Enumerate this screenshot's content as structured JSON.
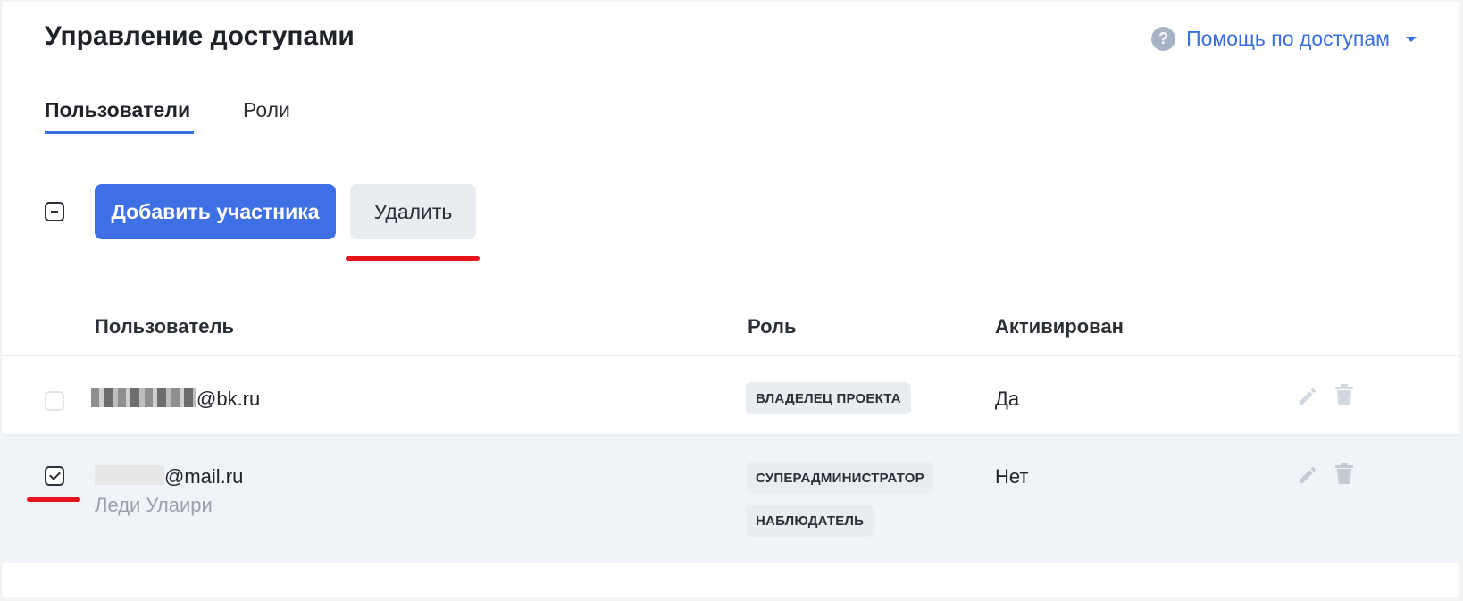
{
  "header": {
    "title": "Управление доступами",
    "help_label": "Помощь по доступам",
    "help_icon_glyph": "?"
  },
  "tabs": [
    {
      "label": "Пользователи",
      "active": true
    },
    {
      "label": "Роли",
      "active": false
    }
  ],
  "toolbar": {
    "add_label": "Добавить участника",
    "delete_label": "Удалить"
  },
  "table": {
    "columns": [
      "Пользователь",
      "Роль",
      "Активирован"
    ],
    "rows": [
      {
        "email_suffix": "@bk.ru",
        "name": "",
        "roles": [
          "ВЛАДЕЛЕЦ ПРОЕКТА"
        ],
        "activated": "Да",
        "selected": false
      },
      {
        "email_suffix": "@mail.ru",
        "name": "Леди Улаири",
        "roles": [
          "СУПЕРАДМИНИСТРАТОР",
          "НАБЛЮДАТЕЛЬ"
        ],
        "activated": "Нет",
        "selected": true
      }
    ]
  },
  "colors": {
    "accent": "#3e6fe4",
    "annotation": "#e8141c",
    "selected_row": "#f0f3f7"
  },
  "icons": [
    "help-circle-icon",
    "chevron-down-icon",
    "pencil-icon",
    "trash-icon",
    "check-icon",
    "minus-icon"
  ]
}
